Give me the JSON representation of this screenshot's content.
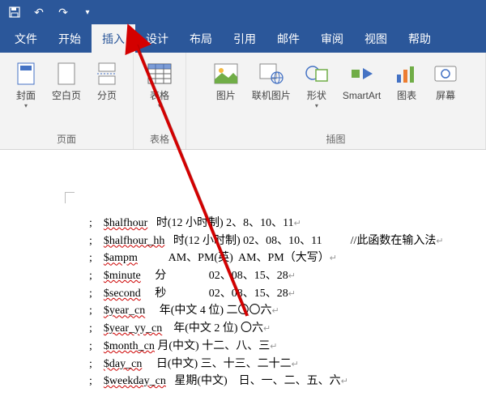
{
  "qat": {
    "save": "💾",
    "undo": "↶",
    "redo": "↷",
    "more": "▾"
  },
  "tabs": {
    "file": "文件",
    "home": "开始",
    "insert": "插入",
    "design": "设计",
    "layout": "布局",
    "references": "引用",
    "mailings": "邮件",
    "review": "审阅",
    "view": "视图",
    "help": "帮助"
  },
  "ribbon": {
    "pages": {
      "label": "页面",
      "cover": "封面",
      "blank": "空白页",
      "break": "分页"
    },
    "tables": {
      "label": "表格",
      "table": "表格"
    },
    "illustrations": {
      "label": "插图",
      "picture": "图片",
      "online_picture": "联机图片",
      "shapes": "形状",
      "smartart": "SmartArt",
      "chart": "图表",
      "screenshot": "屏幕"
    }
  },
  "document": {
    "lines": [
      {
        "pre": ";    ",
        "var": "$halfhour",
        "rest": "   时(12 小时制) 2、8、10、11",
        "comment": ""
      },
      {
        "pre": ";    ",
        "var": "$halfhour_hh",
        "rest": "   时(12 小时制) 02、08、10、11",
        "comment": "          //此函数在输入法"
      },
      {
        "pre": ";    ",
        "var": "$ampm",
        "rest": "           AM、PM(英)  AM、PM（大写）",
        "comment": ""
      },
      {
        "pre": ";    ",
        "var": "$minute",
        "rest": "     分               02、08、15、28",
        "comment": ""
      },
      {
        "pre": ";    ",
        "var": "$second",
        "rest": "     秒               02、08、15、28",
        "comment": ""
      },
      {
        "pre": ";    ",
        "var": "$year_cn",
        "rest": "     年(中文 4 位) 二〇〇六",
        "comment": ""
      },
      {
        "pre": ";    ",
        "var": "$year_yy_cn",
        "rest": "    年(中文 2 位) 〇六",
        "comment": ""
      },
      {
        "pre": ";    ",
        "var": "$month_cn",
        "rest": " 月(中文) 十二、八、三",
        "comment": ""
      },
      {
        "pre": ";    ",
        "var": "$day_cn",
        "rest": "     日(中文) 三、十三、二十二",
        "comment": ""
      },
      {
        "pre": ";    ",
        "var": "$weekday_cn",
        "rest": "   星期(中文)    日、一、二、五、六",
        "comment": ""
      }
    ]
  }
}
